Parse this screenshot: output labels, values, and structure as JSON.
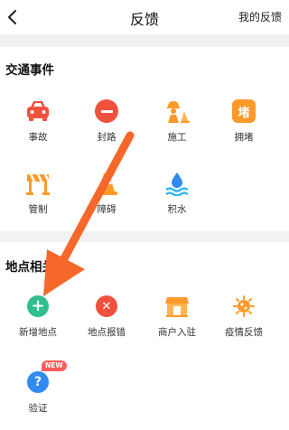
{
  "header": {
    "title": "反馈",
    "right_link": "我的反馈"
  },
  "traffic": {
    "title": "交通事件",
    "items": [
      {
        "label": "事故",
        "icon": "car-accident-icon"
      },
      {
        "label": "封路",
        "icon": "road-closed-icon"
      },
      {
        "label": "施工",
        "icon": "construction-worker-icon"
      },
      {
        "label": "拥堵",
        "icon": "traffic-jam-icon"
      },
      {
        "label": "管制",
        "icon": "barrier-icon"
      },
      {
        "label": "障碍",
        "icon": "traffic-cone-icon"
      },
      {
        "label": "积水",
        "icon": "water-drop-icon"
      }
    ]
  },
  "place": {
    "title": "地点相关",
    "items": [
      {
        "label": "新增地点",
        "icon": "add-location-icon"
      },
      {
        "label": "地点报错",
        "icon": "location-error-icon"
      },
      {
        "label": "商户入驻",
        "icon": "store-icon"
      },
      {
        "label": "疫情反馈",
        "icon": "virus-icon"
      },
      {
        "label": "验证",
        "icon": "question-icon",
        "badge": "NEW"
      }
    ]
  },
  "colors": {
    "accent": "#f5672a",
    "red": "#f0513f",
    "orange": "#ff9a2a",
    "green": "#2fbf8c",
    "blue": "#2f8bf0"
  }
}
